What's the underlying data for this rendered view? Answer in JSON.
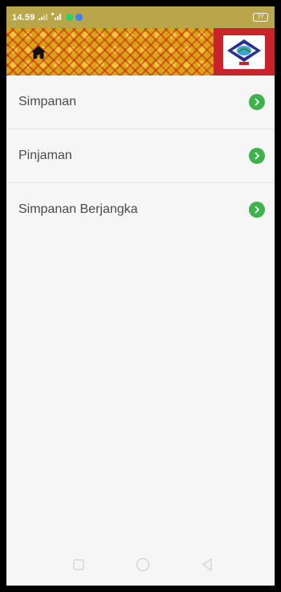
{
  "status_bar": {
    "time": "14.59",
    "battery": "77",
    "icons": [
      "signal-icon",
      "signal-4g-icon",
      "whatsapp-icon",
      "location-icon"
    ]
  },
  "header": {
    "home_icon": "home-icon",
    "logo": "cooperative-logo",
    "colors": {
      "batik_gold": "#d9a417",
      "batik_red": "#c8242c"
    }
  },
  "menu": {
    "items": [
      {
        "label": "Simpanan",
        "icon": "chevron-right-icon"
      },
      {
        "label": "Pinjaman",
        "icon": "chevron-right-icon"
      },
      {
        "label": "Simpanan Berjangka",
        "icon": "chevron-right-icon"
      }
    ],
    "chevron_color": "#3fb24d"
  },
  "nav_bar": {
    "buttons": [
      "recents-icon",
      "home-circle-icon",
      "back-icon"
    ]
  }
}
